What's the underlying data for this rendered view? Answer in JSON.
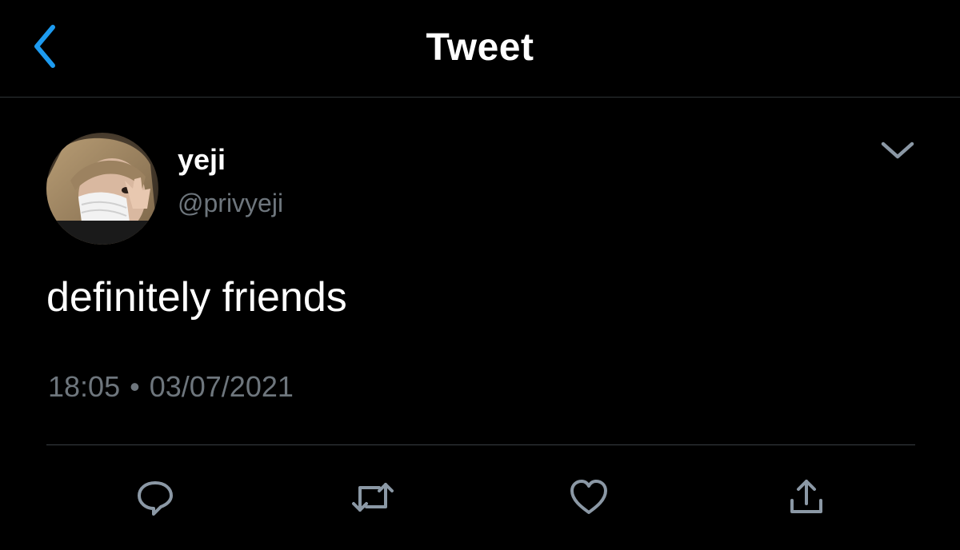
{
  "header": {
    "title": "Tweet",
    "back_icon": "chevron-left-icon"
  },
  "tweet": {
    "author": {
      "display_name": "yeji",
      "handle": "@privyeji",
      "avatar": "avatar-photo"
    },
    "text": "definitely friends",
    "time": "18:05",
    "separator": "•",
    "date": "03/07/2021",
    "more_icon": "chevron-down-icon"
  },
  "actions": [
    {
      "name": "reply",
      "icon": "reply-icon"
    },
    {
      "name": "retweet",
      "icon": "retweet-icon"
    },
    {
      "name": "like",
      "icon": "heart-icon"
    },
    {
      "name": "share",
      "icon": "share-icon"
    }
  ],
  "colors": {
    "background": "#000000",
    "accent": "#1d9bf0",
    "text_primary": "#ffffff",
    "text_secondary": "#6e767d",
    "icon": "#8b98a5",
    "divider": "#2f3336"
  }
}
